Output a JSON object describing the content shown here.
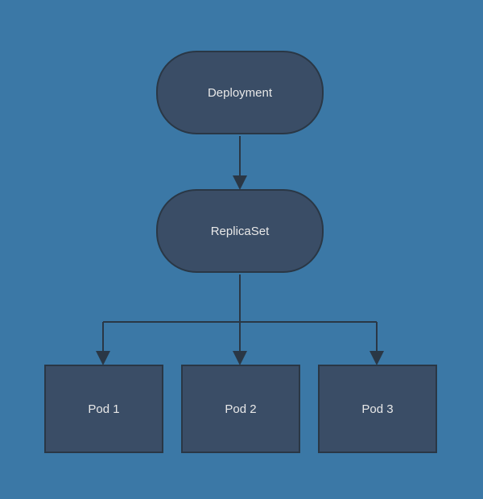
{
  "diagram": {
    "nodes": {
      "deployment": {
        "label": "Deployment"
      },
      "replicaset": {
        "label": "ReplicaSet"
      },
      "pod1": {
        "label": "Pod 1"
      },
      "pod2": {
        "label": "Pod 2"
      },
      "pod3": {
        "label": "Pod 3"
      }
    },
    "edges": [
      {
        "from": "deployment",
        "to": "replicaset"
      },
      {
        "from": "replicaset",
        "to": "pod1"
      },
      {
        "from": "replicaset",
        "to": "pod2"
      },
      {
        "from": "replicaset",
        "to": "pod3"
      }
    ]
  }
}
